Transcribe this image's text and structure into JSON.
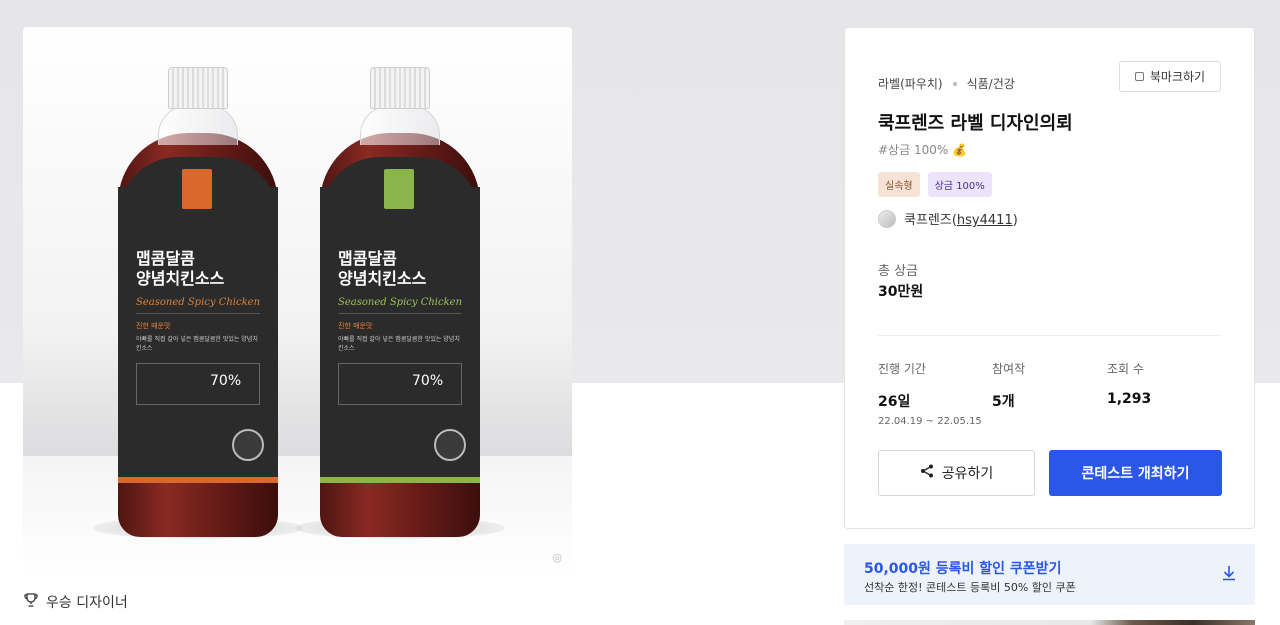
{
  "gallery": {
    "bottle_title": "맵콤달콤\n양념치킨소스",
    "bottle_script": "Seasoned Spicy Chicken",
    "bottle_tag": "진한 매운맛",
    "bottle_desc": "아빠를 직접 갈아 넣은 맵콤달콤한 맛있는 양념치킨소스",
    "bottle_percent": "70%",
    "bottle_color_1": "#d9682c",
    "bottle_color_2": "#8ab54a",
    "winner_label": "우승 디자이너",
    "winner_icon": "trophy-icon"
  },
  "contest": {
    "category": "라벨(파우치)",
    "subcategory": "식품/건강",
    "bookmark_label": "북마크하기",
    "title": "쿡프렌즈 라벨 디자인의뢰",
    "hashtag": "#상금 100% 💰",
    "tags": [
      "실속형",
      "상금 100%"
    ],
    "host_name": "쿡프렌즈",
    "host_id": "hsy4411",
    "prize_label": "총 상금",
    "prize_value": "30만원",
    "stats": {
      "period_label": "진행 기간",
      "period_value": "26일",
      "period_range": "22.04.19 ~ 22.05.15",
      "entries_label": "참여작",
      "entries_value": "5개",
      "views_label": "조회 수",
      "views_value": "1,293"
    },
    "share_label": "공유하기",
    "host_contest_label": "콘테스트 개최하기",
    "accent_color": "#2b57e9"
  },
  "coupon": {
    "title": "50,000원 등록비 할인 쿠폰받기",
    "subtitle": "선착순 한정! 콘테스트 등록비 50% 할인 쿠폰",
    "icon": "download-icon"
  }
}
